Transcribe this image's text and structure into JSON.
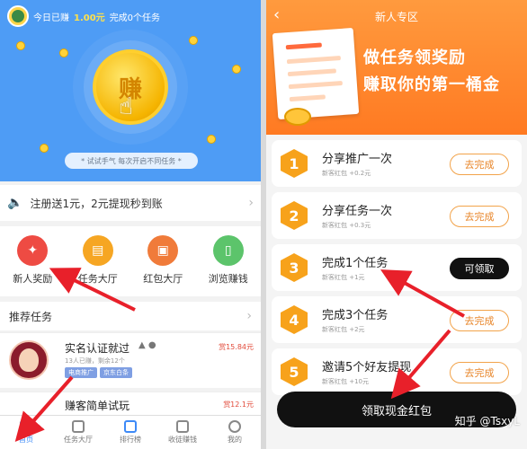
{
  "left": {
    "status": {
      "earned_prefix": "今日已赚",
      "earned_amount": "1.00元",
      "completed_text": "完成0个任务"
    },
    "hero": {
      "coin_char": "赚",
      "hint": "* 试试手气 每次开启不同任务 *"
    },
    "notice": {
      "text": "注册送1元，2元提现秒到账"
    },
    "quick": [
      {
        "label": "新人奖励",
        "color": "#ee4b43"
      },
      {
        "label": "任务大厅",
        "color": "#f6a623"
      },
      {
        "label": "红包大厅",
        "color": "#f07b3a"
      },
      {
        "label": "浏览赚钱",
        "color": "#5cc46b"
      }
    ],
    "recommend_title": "推荐任务",
    "task1": {
      "title": "实名认证就过",
      "sub": "13人已赚，剩余12个",
      "reward": "赏15.84元",
      "tags": [
        "电商推广",
        "京东白条"
      ]
    },
    "task2": {
      "title": "赚客简单试玩",
      "reward": "赏12.1元"
    },
    "tabs": [
      {
        "label": "首页",
        "active": true
      },
      {
        "label": "任务大厅",
        "active": false
      },
      {
        "label": "排行榜",
        "active": false
      },
      {
        "label": "收徒赚钱",
        "active": false
      },
      {
        "label": "我的",
        "active": false
      }
    ]
  },
  "right": {
    "title": "新人专区",
    "headline1": "做任务领奖励",
    "headline2": "赚取你的第一桶金",
    "steps": [
      {
        "num": "1",
        "title": "分享推广一次",
        "sub": "新客红包 +0.2元",
        "button": "去完成",
        "dark": false
      },
      {
        "num": "2",
        "title": "分享任务一次",
        "sub": "新客红包 +0.3元",
        "button": "去完成",
        "dark": false
      },
      {
        "num": "3",
        "title": "完成1个任务",
        "sub": "新客红包 +1元",
        "button": "可领取",
        "dark": true
      },
      {
        "num": "4",
        "title": "完成3个任务",
        "sub": "新客红包 +2元",
        "button": "去完成",
        "dark": false
      },
      {
        "num": "5",
        "title": "邀请5个好友提现",
        "sub": "新客红包 +10元",
        "button": "去完成",
        "dark": false
      }
    ],
    "cta": "领取现金红包",
    "watermark": "知乎 @TsxyL"
  },
  "colors": {
    "blue": "#4e9cf5",
    "orange": "#ff7a22",
    "arrow": "#e8202a"
  }
}
